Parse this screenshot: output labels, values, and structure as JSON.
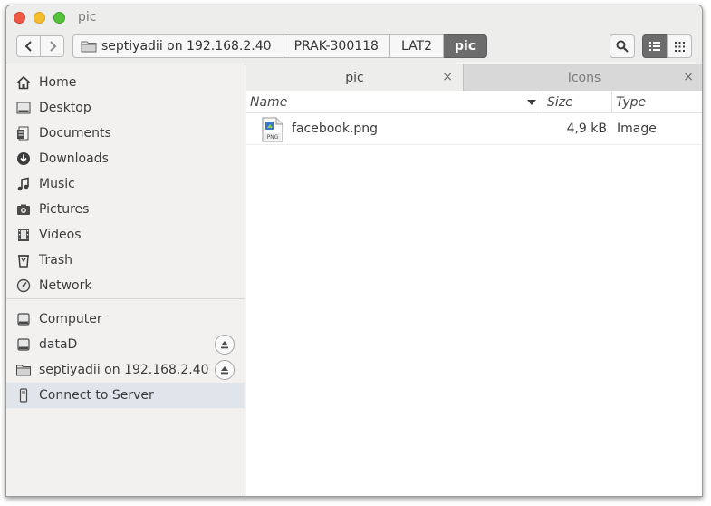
{
  "window": {
    "title": "pic"
  },
  "breadcrumbs": [
    "septiyadii on 192.168.2.40",
    "PRAK-300118",
    "LAT2",
    "pic"
  ],
  "sidebar": {
    "places": [
      {
        "label": "Home",
        "icon": "home-icon"
      },
      {
        "label": "Desktop",
        "icon": "desktop-icon"
      },
      {
        "label": "Documents",
        "icon": "documents-icon"
      },
      {
        "label": "Downloads",
        "icon": "downloads-icon"
      },
      {
        "label": "Music",
        "icon": "music-icon"
      },
      {
        "label": "Pictures",
        "icon": "pictures-icon"
      },
      {
        "label": "Videos",
        "icon": "videos-icon"
      },
      {
        "label": "Trash",
        "icon": "trash-icon"
      },
      {
        "label": "Network",
        "icon": "network-icon"
      }
    ],
    "devices": [
      {
        "label": "Computer",
        "icon": "computer-icon"
      },
      {
        "label": "dataD",
        "icon": "drive-icon"
      },
      {
        "label": "septiyadii on 192.168.2.40",
        "icon": "network-folder-icon"
      },
      {
        "label": "Connect to Server",
        "icon": "server-icon"
      }
    ]
  },
  "tabs": [
    {
      "label": "pic",
      "close": "×"
    },
    {
      "label": "Icons",
      "close": "×"
    }
  ],
  "columns": {
    "name": "Name",
    "size": "Size",
    "type": "Type"
  },
  "files": [
    {
      "name": "facebook.png",
      "size": "4,9 kB",
      "type": "Image",
      "icon_badge": "PNG"
    }
  ]
}
